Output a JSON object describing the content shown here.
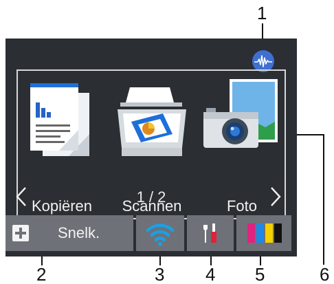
{
  "callouts": [
    "1",
    "2",
    "3",
    "4",
    "5",
    "6"
  ],
  "apps": [
    {
      "label": "Kopiëren",
      "icon": "copy-icon"
    },
    {
      "label": "Scannen",
      "icon": "scanner-icon"
    },
    {
      "label": "Foto",
      "icon": "photo-camera-icon"
    }
  ],
  "pagination": {
    "text": "1 / 2"
  },
  "bottom_bar": {
    "shortcut_label": "Snelk.",
    "wifi_icon": "wifi-icon",
    "settings_icon": "settings-tools-icon",
    "ink_icon": "ink-cartridges-icon"
  },
  "status_icon": "wireless-direct-status-icon",
  "colors": {
    "screen": "#2b2e33",
    "button": "#6e7178",
    "wifi": "#1aa0e6",
    "ink": [
      "#e0237e",
      "#1e88e5",
      "#f5d000",
      "#111111"
    ]
  }
}
